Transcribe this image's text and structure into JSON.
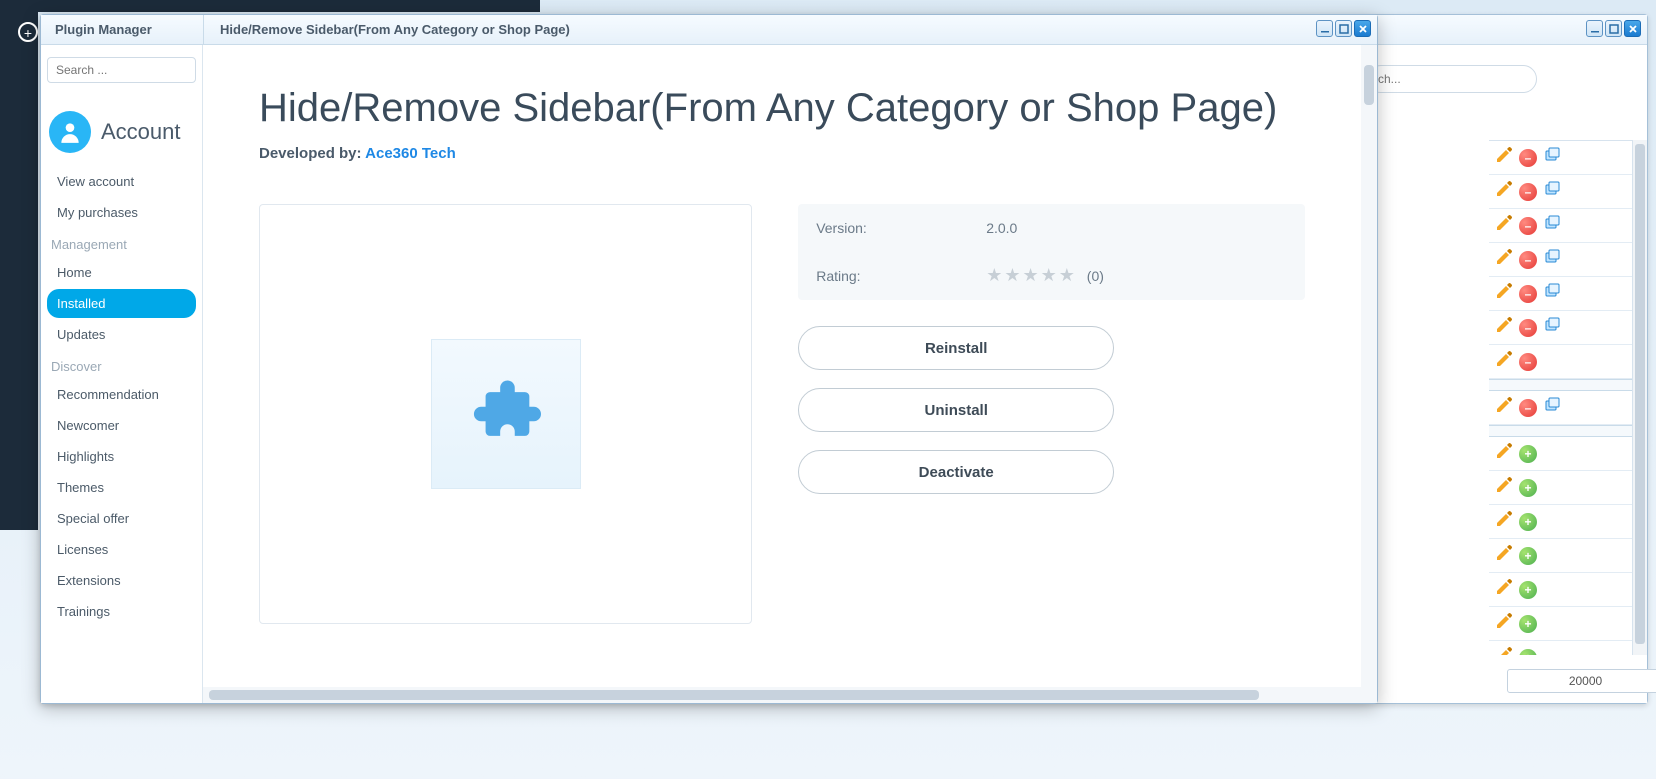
{
  "backdrop": {
    "plus_glyph": "+"
  },
  "outer_window": {
    "search_placeholder": "ch...",
    "bottom_value": "20000",
    "rows": [
      {
        "icons": [
          "pencil",
          "minus",
          "dup"
        ]
      },
      {
        "icons": [
          "pencil",
          "minus",
          "dup"
        ]
      },
      {
        "icons": [
          "pencil",
          "minus",
          "dup"
        ]
      },
      {
        "icons": [
          "pencil",
          "minus",
          "dup"
        ]
      },
      {
        "icons": [
          "pencil",
          "minus",
          "dup"
        ]
      },
      {
        "icons": [
          "pencil",
          "minus",
          "dup"
        ]
      },
      {
        "icons": [
          "pencil",
          "minus"
        ]
      },
      {
        "sep": true
      },
      {
        "icons": [
          "pencil",
          "minus",
          "dup"
        ]
      },
      {
        "sep": true
      },
      {
        "icons": [
          "pencil",
          "plus"
        ]
      },
      {
        "icons": [
          "pencil",
          "plus"
        ]
      },
      {
        "icons": [
          "pencil",
          "plus"
        ]
      },
      {
        "icons": [
          "pencil",
          "plus"
        ]
      },
      {
        "icons": [
          "pencil",
          "plus"
        ]
      },
      {
        "icons": [
          "pencil",
          "plus"
        ]
      },
      {
        "icons": [
          "pencil",
          "plus"
        ]
      }
    ]
  },
  "pm": {
    "title": "Plugin Manager",
    "detail_title": "Hide/Remove Sidebar(From Any Category or Shop Page)",
    "search_placeholder": "Search ...",
    "account_label": "Account",
    "groups": {
      "account": [
        {
          "label": "View account",
          "active": false
        },
        {
          "label": "My purchases",
          "active": false
        }
      ],
      "management_label": "Management",
      "management": [
        {
          "label": "Home",
          "active": false
        },
        {
          "label": "Installed",
          "active": true
        },
        {
          "label": "Updates",
          "active": false
        }
      ],
      "discover_label": "Discover",
      "discover": [
        {
          "label": "Recommendation"
        },
        {
          "label": "Newcomer"
        },
        {
          "label": "Highlights"
        },
        {
          "label": "Themes"
        },
        {
          "label": "Special offer"
        },
        {
          "label": "Licenses"
        },
        {
          "label": "Extensions"
        },
        {
          "label": "Trainings"
        }
      ]
    },
    "plugin": {
      "name": "Hide/Remove Sidebar(From Any Category or Shop Page)",
      "developed_by_label": "Developed by: ",
      "developer": "Ace360 Tech",
      "version_label": "Version:",
      "version": "2.0.0",
      "rating_label": "Rating:",
      "rating_count": "(0)",
      "star_glyph": "★★★★★",
      "buttons": {
        "reinstall": "Reinstall",
        "uninstall": "Uninstall",
        "deactivate": "Deactivate"
      }
    }
  }
}
